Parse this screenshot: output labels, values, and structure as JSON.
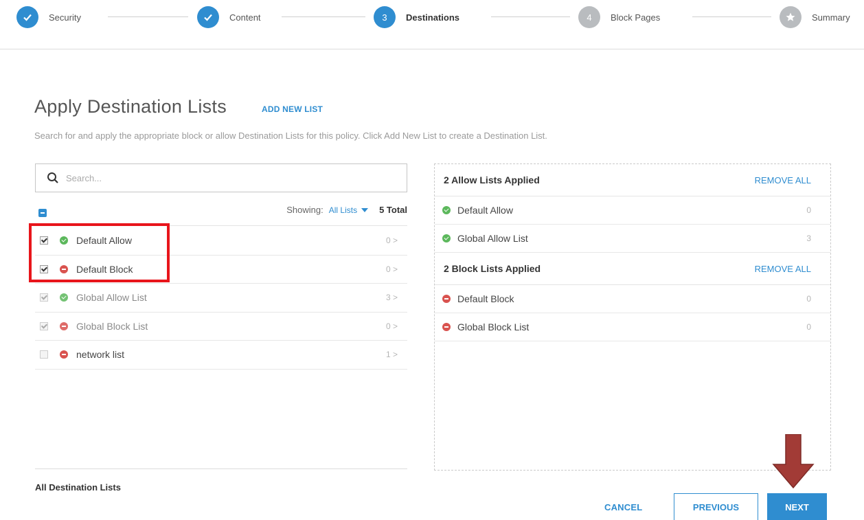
{
  "stepper": {
    "steps": [
      {
        "label": "Security",
        "state": "done",
        "number": ""
      },
      {
        "label": "Content",
        "state": "done",
        "number": ""
      },
      {
        "label": "Destinations",
        "state": "active",
        "number": "3"
      },
      {
        "label": "Block Pages",
        "state": "todo",
        "number": "4"
      },
      {
        "label": "Summary",
        "state": "todo",
        "number": ""
      }
    ]
  },
  "header": {
    "title": "Apply Destination Lists",
    "add_new_list": "ADD NEW LIST",
    "description": "Search for and apply the appropriate block or allow Destination Lists for this policy. Click Add New List to create a Destination List."
  },
  "search": {
    "placeholder": "Search...",
    "value": ""
  },
  "toolbar": {
    "showing_label": "Showing:",
    "showing_value": "All Lists",
    "total": "5 Total"
  },
  "lists": [
    {
      "name": "Default Allow",
      "type": "allow",
      "count": "0 >",
      "checked": true
    },
    {
      "name": "Default Block",
      "type": "block",
      "count": "0 >",
      "checked": true
    },
    {
      "name": "Global Allow List",
      "type": "allow",
      "count": "3 >",
      "checked": true
    },
    {
      "name": "Global Block List",
      "type": "block",
      "count": "0 >",
      "checked": true
    },
    {
      "name": "network list",
      "type": "block",
      "count": "1 >",
      "checked": false
    }
  ],
  "left_footer": "All Destination Lists",
  "applied": {
    "allow": {
      "title": "2 Allow Lists Applied",
      "remove_all": "REMOVE ALL",
      "items": [
        {
          "name": "Default Allow",
          "count": "0"
        },
        {
          "name": "Global Allow List",
          "count": "3"
        }
      ]
    },
    "block": {
      "title": "2 Block Lists Applied",
      "remove_all": "REMOVE ALL",
      "items": [
        {
          "name": "Default Block",
          "count": "0"
        },
        {
          "name": "Global Block List",
          "count": "0"
        }
      ]
    }
  },
  "buttons": {
    "cancel": "CANCEL",
    "previous": "PREVIOUS",
    "next": "NEXT"
  },
  "colors": {
    "accent": "#2f8dd0",
    "allow": "#5cb85c",
    "block": "#d9534f",
    "highlight": "#e8151b",
    "arrow": "#a23b36"
  }
}
